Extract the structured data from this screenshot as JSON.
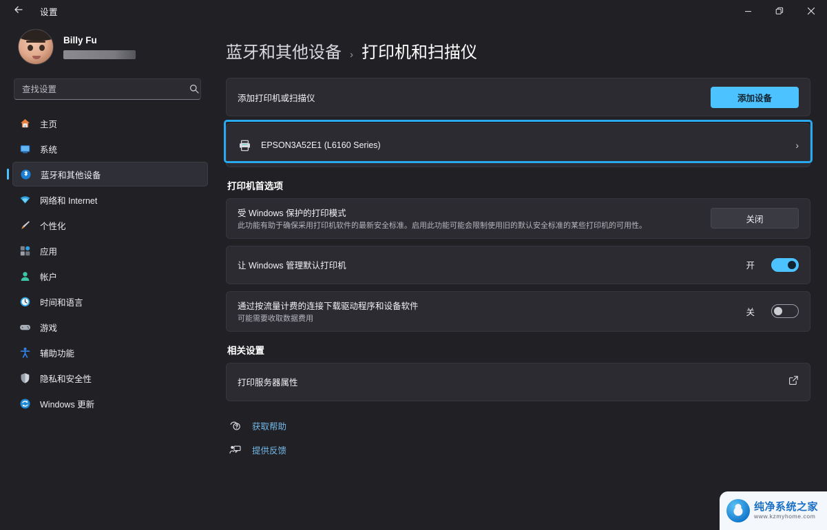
{
  "window": {
    "app_title": "设置",
    "back_icon": "back-arrow-icon",
    "controls": {
      "minimize": "−",
      "maximize": "❐",
      "close": "✕"
    }
  },
  "sidebar": {
    "profile": {
      "name": "Billy Fu",
      "email_masked": ""
    },
    "search": {
      "placeholder": "查找设置",
      "value": "",
      "icon": "search-icon"
    },
    "items": [
      {
        "label": "主页",
        "icon": "home-icon",
        "active": false
      },
      {
        "label": "系统",
        "icon": "system-icon",
        "active": false
      },
      {
        "label": "蓝牙和其他设备",
        "icon": "bluetooth-icon",
        "active": true
      },
      {
        "label": "网络和 Internet",
        "icon": "network-icon",
        "active": false
      },
      {
        "label": "个性化",
        "icon": "personalization-icon",
        "active": false
      },
      {
        "label": "应用",
        "icon": "apps-icon",
        "active": false
      },
      {
        "label": "帐户",
        "icon": "accounts-icon",
        "active": false
      },
      {
        "label": "时间和语言",
        "icon": "time-language-icon",
        "active": false
      },
      {
        "label": "游戏",
        "icon": "gaming-icon",
        "active": false
      },
      {
        "label": "辅助功能",
        "icon": "accessibility-icon",
        "active": false
      },
      {
        "label": "隐私和安全性",
        "icon": "privacy-security-icon",
        "active": false
      },
      {
        "label": "Windows 更新",
        "icon": "windows-update-icon",
        "active": false
      }
    ]
  },
  "main": {
    "breadcrumb": {
      "parent": "蓝牙和其他设备",
      "separator": "›",
      "current": "打印机和扫描仪"
    },
    "add_printer": {
      "label": "添加打印机或扫描仪",
      "button": "添加设备"
    },
    "printer": {
      "name": "EPSON3A52E1 (L6160 Series)",
      "icon": "printer-icon",
      "chevron": "›",
      "highlighted": true
    },
    "preferences_heading": "打印机首选项",
    "preferences": [
      {
        "title": "受 Windows 保护的打印模式",
        "subtitle": "此功能有助于确保采用打印机软件的最新安全标准。启用此功能可能会限制使用旧的默认安全标准的某些打印机的可用性。",
        "control": "button",
        "button_label": "关闭"
      },
      {
        "title": "让 Windows 管理默认打印机",
        "subtitle": "",
        "control": "toggle",
        "state_label": "开",
        "state_on": true
      },
      {
        "title": "通过按流量计费的连接下载驱动程序和设备软件",
        "subtitle": "可能需要收取数据费用",
        "control": "toggle",
        "state_label": "关",
        "state_on": false
      }
    ],
    "related_heading": "相关设置",
    "related": [
      {
        "title": "打印服务器属性",
        "icon": "external-link-icon"
      }
    ],
    "links": [
      {
        "label": "获取帮助",
        "icon": "help-icon"
      },
      {
        "label": "提供反馈",
        "icon": "feedback-icon"
      }
    ]
  },
  "watermark": {
    "title": "纯净系统之家",
    "url": "www.kzmyhome.com",
    "logo": "site-logo-icon"
  },
  "colors": {
    "accent": "#4cc2ff",
    "highlight": "#29a9f0",
    "background": "#202025",
    "card": "#2b2b31",
    "link": "#74b8e8"
  }
}
